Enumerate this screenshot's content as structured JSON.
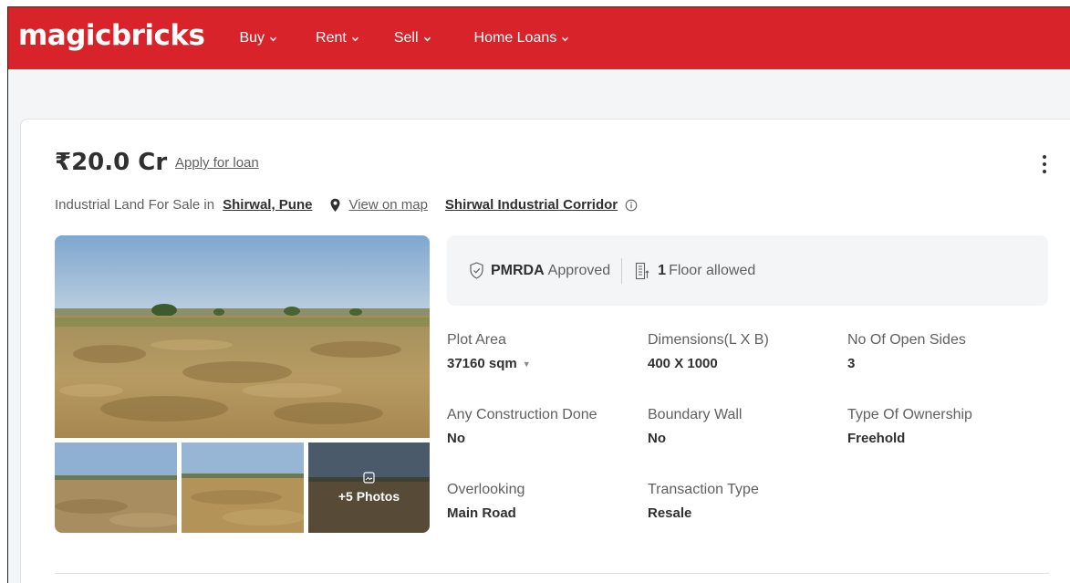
{
  "header": {
    "logo": "magicbricks",
    "nav": [
      {
        "label": "Buy"
      },
      {
        "label": "Rent"
      },
      {
        "label": "Sell"
      },
      {
        "label": "Home Loans"
      }
    ],
    "brand_color": "#d8232a"
  },
  "listing": {
    "price": "₹20.0 Cr",
    "apply_loan": "Apply for loan",
    "subtitle_prefix": "Industrial Land For Sale in",
    "location": "Shirwal, Pune",
    "view_on_map": "View on map",
    "corridor": "Shirwal Industrial Corridor",
    "approval": {
      "authority": "PMRDA",
      "approved_label": "Approved",
      "floors": "1",
      "floors_label": "Floor allowed"
    },
    "gallery": {
      "more_photos": "+5 Photos"
    },
    "specs": [
      {
        "label": "Plot Area",
        "value": "37160 sqm"
      },
      {
        "label": "Dimensions(L X B)",
        "value": "400 X 1000"
      },
      {
        "label": "No Of Open Sides",
        "value": "3"
      },
      {
        "label": "Any Construction Done",
        "value": "No"
      },
      {
        "label": "Boundary Wall",
        "value": "No"
      },
      {
        "label": "Type Of Ownership",
        "value": "Freehold"
      },
      {
        "label": "Overlooking",
        "value": "Main Road"
      },
      {
        "label": "Transaction Type",
        "value": "Resale"
      }
    ]
  }
}
